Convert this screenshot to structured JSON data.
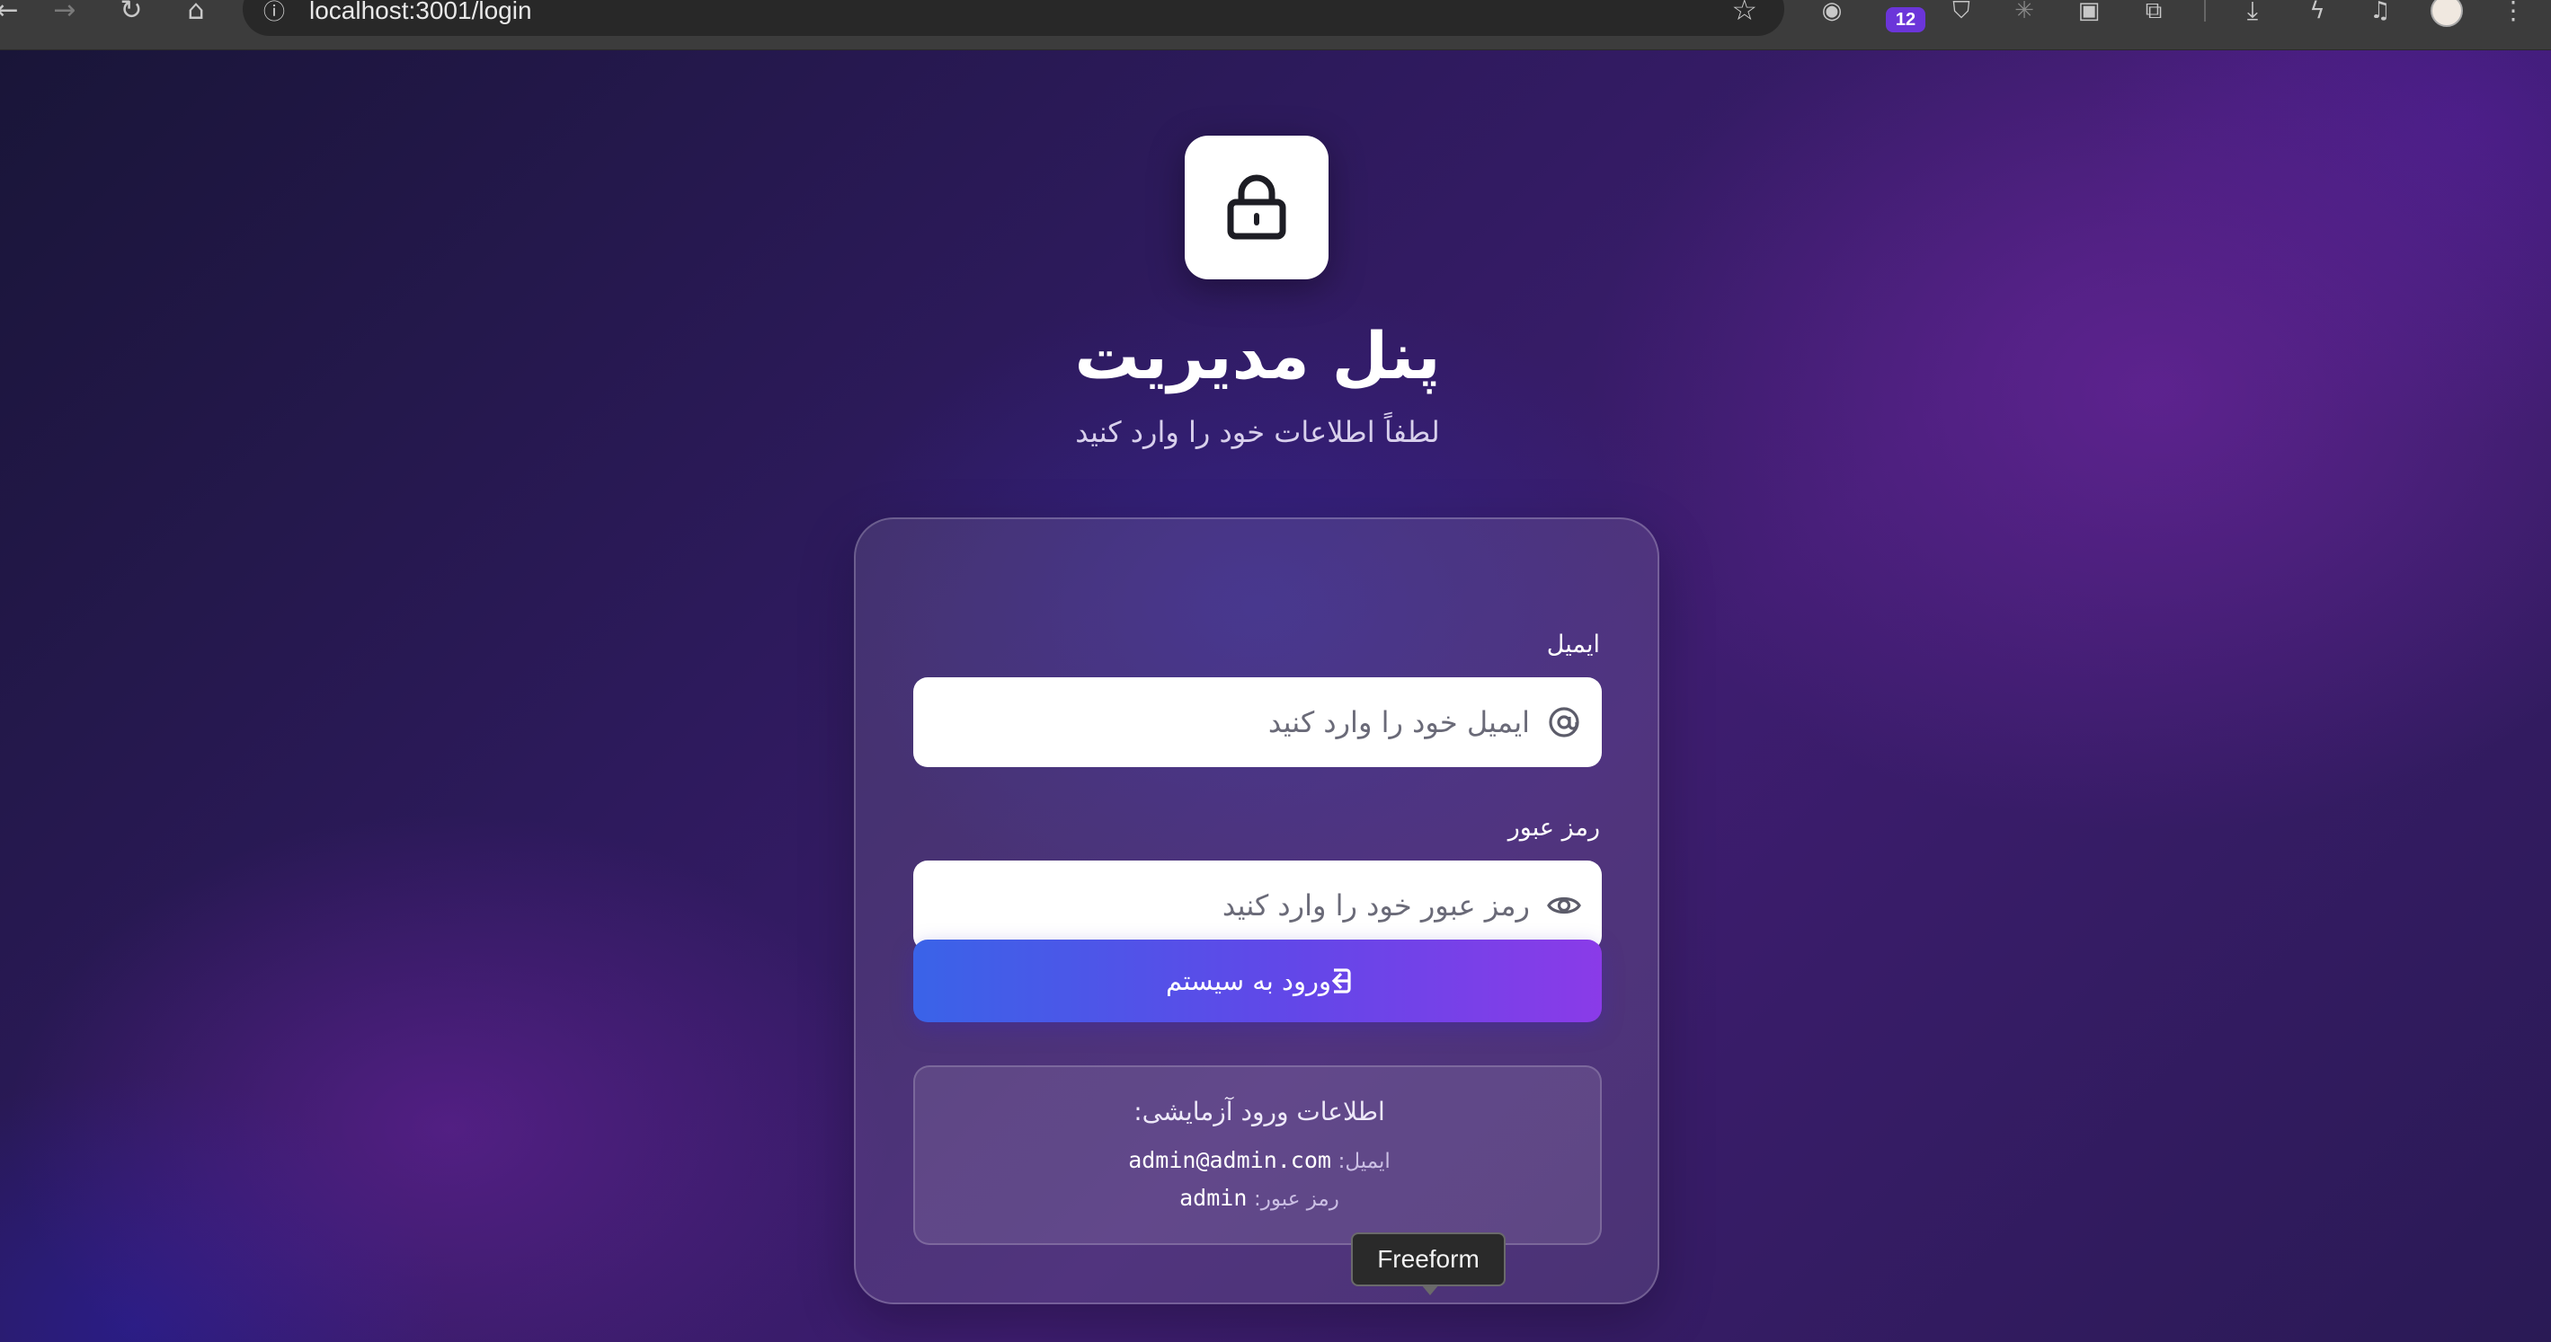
{
  "browser": {
    "url": "localhost:3001/login",
    "extension_badge": "12",
    "icons": [
      "back-icon",
      "forward-icon",
      "reload-icon",
      "home-icon",
      "info-icon",
      "star-icon",
      "download-icon",
      "menu-icon"
    ]
  },
  "page": {
    "icon": "lock-icon",
    "title": "پنل مدیریت",
    "subtitle": "لطفاً اطلاعات خود را وارد کنید"
  },
  "form": {
    "email_label": "ایمیل",
    "email_placeholder": "ایمیل خود را وارد کنید",
    "email_icon": "at-sign-icon",
    "password_label": "رمز عبور",
    "password_placeholder": "رمز عبور خود را وارد کنید",
    "password_icon": "eye-icon",
    "submit_label": "ورود به سیستم",
    "submit_icon": "login-icon"
  },
  "demo": {
    "title": "اطلاعات ورود آزمایشی:",
    "email_key": "ایمیل:",
    "email_value": "admin@admin.com",
    "password_key": "رمز عبور:",
    "password_value": "admin"
  },
  "tooltip": "Freeform",
  "colors": {
    "accent_start": "#3a63e8",
    "accent_end": "#8a3be8",
    "background": "#2d1a5c"
  }
}
